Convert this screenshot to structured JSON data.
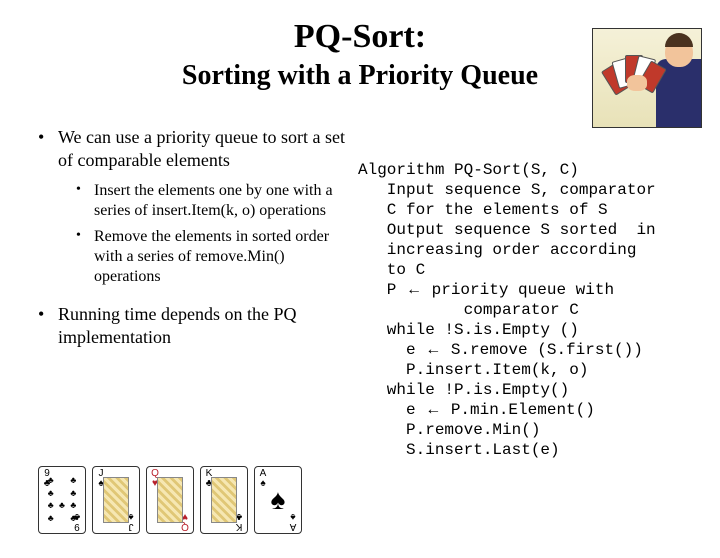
{
  "title": "PQ-Sort:",
  "subtitle": "Sorting with a Priority Queue",
  "bullets": {
    "b1": "We can use a priority queue to sort a set of comparable elements",
    "b1a_pre": "Insert the elements one by one with a series of ",
    "b1a_em": "insert.Item(k, o)",
    "b1a_post": " operations",
    "b1b_pre": "Remove the elements in sorted order with a series of ",
    "b1b_em": "remove.Min()",
    "b1b_post": " operations",
    "b2": "Running time depends on the PQ implementation"
  },
  "algo": {
    "l1": "Algorithm PQ-Sort(S, C)",
    "l2": "   Input sequence S, comparator",
    "l3": "   C for the elements of S",
    "l4": "   Output sequence S sorted  in",
    "l5": "   increasing order according",
    "l6": "   to C",
    "l7a": "   P ",
    "l7b": " priority queue with",
    "l8": "           comparator C",
    "l9": "   while !S.is.Empty ()",
    "l10a": "     e ",
    "l10b": " S.remove (S.first())",
    "l11": "     P.insert.Item(k, o)",
    "l12": "   while !P.is.Empty()",
    "l13a": "     e ",
    "l13b": " P.min.Element()",
    "l14": "     P.remove.Min()",
    "l15": "     S.insert.Last(e)"
  },
  "arrow": "←",
  "cards": [
    {
      "rank": "9",
      "suit": "♣",
      "color": "black",
      "type": "pip"
    },
    {
      "rank": "J",
      "suit": "♠",
      "color": "black",
      "type": "face"
    },
    {
      "rank": "Q",
      "suit": "♥",
      "color": "red",
      "type": "face"
    },
    {
      "rank": "K",
      "suit": "♣",
      "color": "black",
      "type": "face"
    },
    {
      "rank": "A",
      "suit": "♠",
      "color": "black",
      "type": "ace"
    }
  ]
}
